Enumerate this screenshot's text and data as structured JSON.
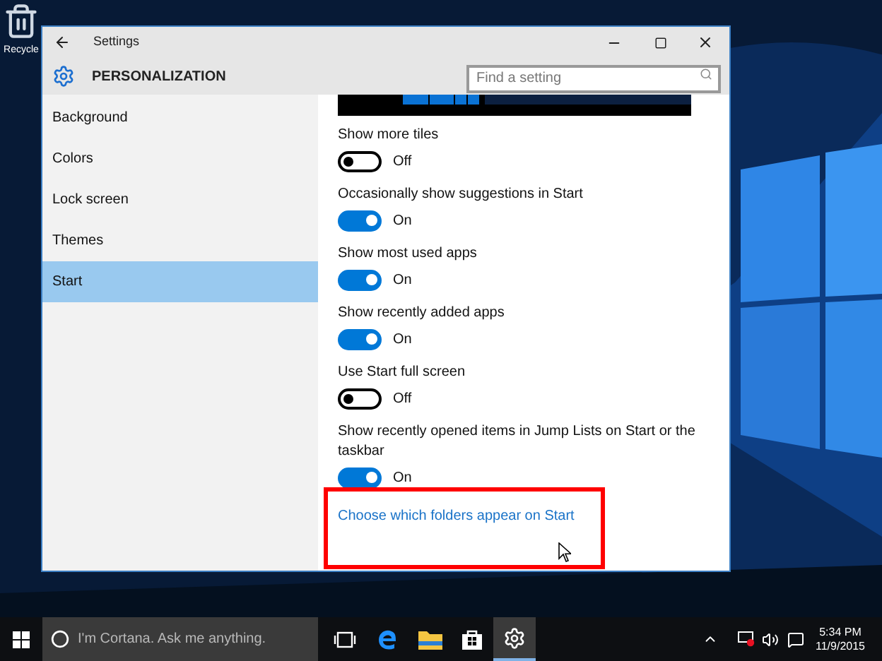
{
  "desktop": {
    "icons": [
      {
        "label": "Recycle"
      }
    ]
  },
  "window": {
    "title": "Settings",
    "header": "PERSONALIZATION",
    "search": {
      "placeholder": "Find a setting"
    },
    "sidebar": {
      "items": [
        {
          "label": "Background",
          "selected": false
        },
        {
          "label": "Colors",
          "selected": false
        },
        {
          "label": "Lock screen",
          "selected": false
        },
        {
          "label": "Themes",
          "selected": false
        },
        {
          "label": "Start",
          "selected": true
        }
      ]
    },
    "settings": [
      {
        "label": "Show more tiles",
        "on": false,
        "state_text": "Off"
      },
      {
        "label": "Occasionally show suggestions in Start",
        "on": true,
        "state_text": "On"
      },
      {
        "label": "Show most used apps",
        "on": true,
        "state_text": "On"
      },
      {
        "label": "Show recently added apps",
        "on": true,
        "state_text": "On"
      },
      {
        "label": "Use Start full screen",
        "on": false,
        "state_text": "Off"
      },
      {
        "label": "Show recently opened items in Jump Lists on Start or the taskbar",
        "on": true,
        "state_text": "On"
      }
    ],
    "link": "Choose which folders appear on Start"
  },
  "taskbar": {
    "search_placeholder": "I'm Cortana. Ask me anything.",
    "apps": [
      {
        "kind": "task-view",
        "selected": false
      },
      {
        "kind": "browser",
        "selected": false
      },
      {
        "kind": "folder",
        "selected": false
      },
      {
        "kind": "store",
        "selected": false
      },
      {
        "kind": "settings",
        "selected": true
      }
    ],
    "time": "5:34 PM",
    "date": "11/9/2015"
  }
}
